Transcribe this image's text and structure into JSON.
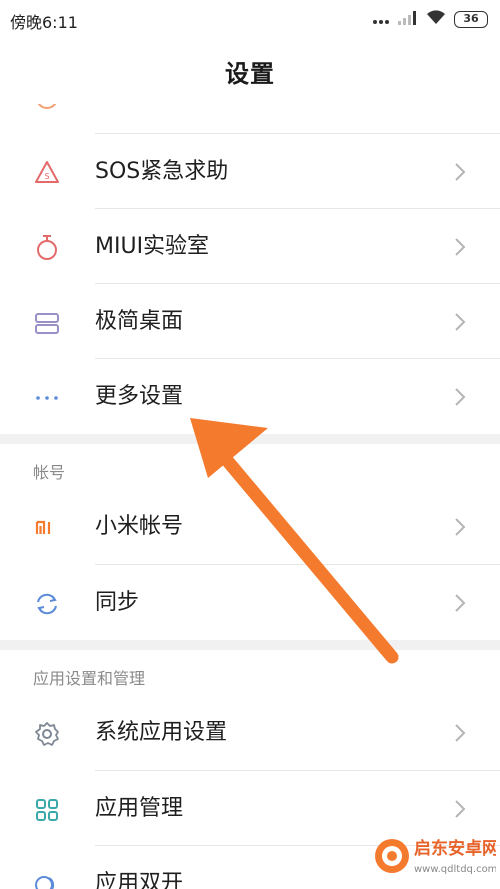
{
  "status_bar": {
    "time": "傍晚6:11",
    "battery": "36"
  },
  "header": {
    "title": "设置"
  },
  "items": {
    "sos": {
      "label": "SOS紧急求助",
      "icon": "sos-icon"
    },
    "miui_lab": {
      "label": "MIUI实验室",
      "icon": "flask-icon"
    },
    "simple_launcher": {
      "label": "极简桌面",
      "icon": "simple-desktop-icon"
    },
    "more_settings": {
      "label": "更多设置",
      "icon": "more-dots-icon"
    },
    "mi_account": {
      "label": "小米帐号",
      "icon": "mi-logo-icon"
    },
    "sync": {
      "label": "同步",
      "icon": "sync-icon"
    },
    "system_apps": {
      "label": "系统应用设置",
      "icon": "gear-icon"
    },
    "app_manage": {
      "label": "应用管理",
      "icon": "grid-icon"
    },
    "dual_apps": {
      "label": "应用双开",
      "icon": "dual-circle-icon"
    }
  },
  "sections": {
    "account": "帐号",
    "apps": "应用设置和管理"
  },
  "watermark": {
    "text": "启东安卓网",
    "url": "www.qdltdq.com"
  },
  "colors": {
    "accent_orange": "#F47A2E",
    "icon_red": "#E46A6A",
    "icon_purple": "#9B8FC8",
    "icon_blue": "#5B8BD9",
    "icon_teal": "#3BA9AA",
    "icon_gray": "#7D8794"
  }
}
